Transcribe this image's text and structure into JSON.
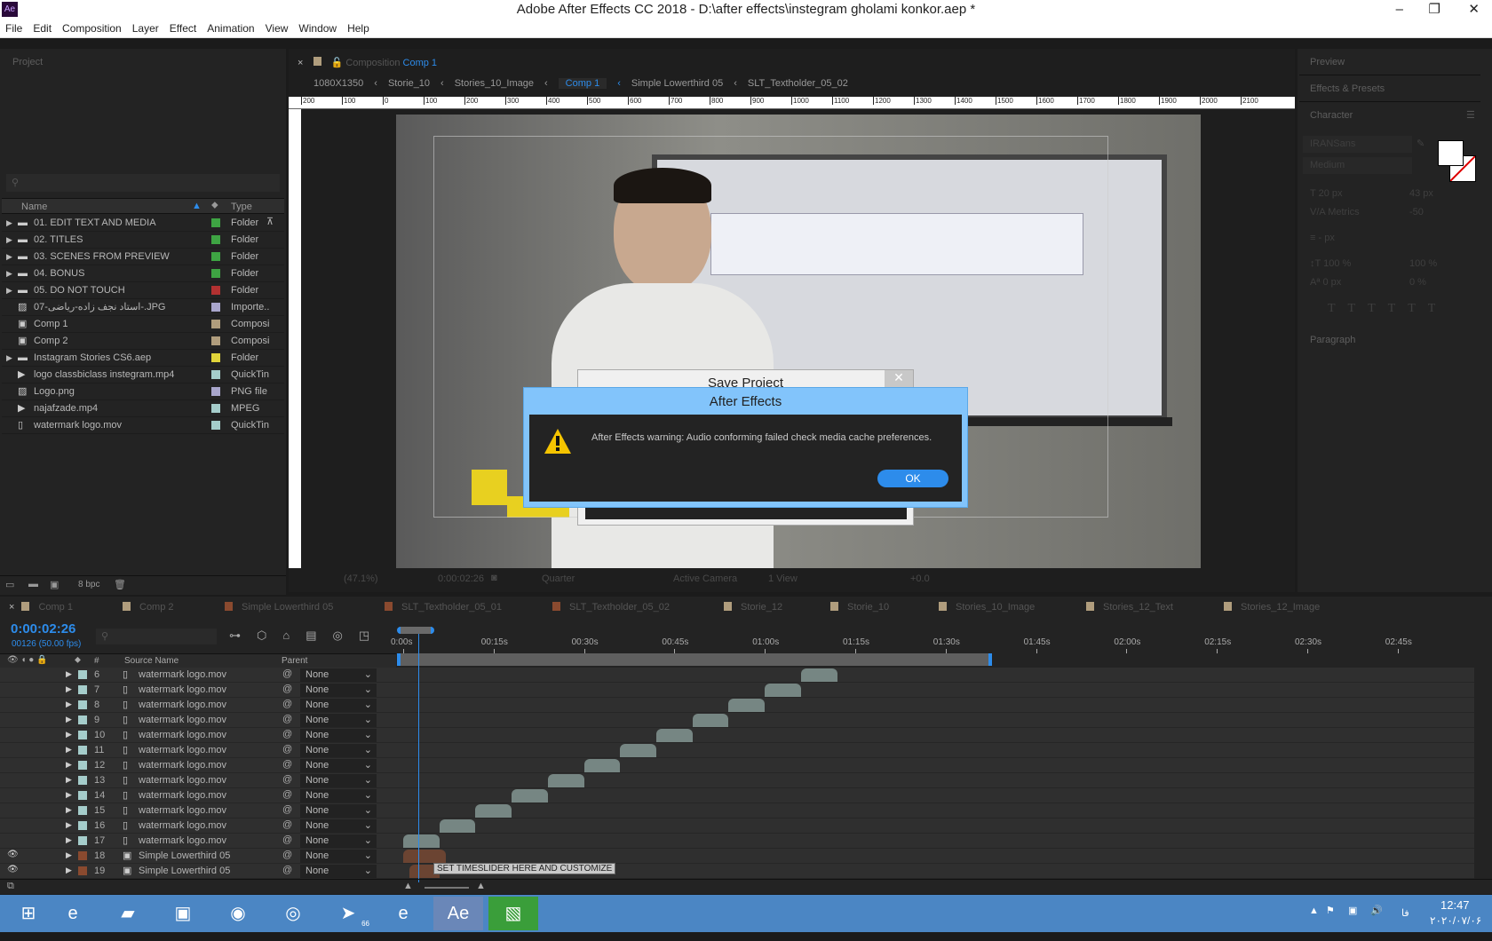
{
  "window": {
    "title": "Adobe After Effects CC 2018 - D:\\after effects\\instegram gholami konkor.aep *",
    "app_icon": "Ae"
  },
  "menu": [
    "File",
    "Edit",
    "Composition",
    "Layer",
    "Effect",
    "Animation",
    "View",
    "Window",
    "Help"
  ],
  "project": {
    "title": "Project",
    "columns": {
      "name": "Name",
      "type": "Type"
    },
    "bpc": "8 bpc",
    "items": [
      {
        "name": "01. EDIT TEXT AND MEDIA",
        "type": "Folder",
        "color": "#3ea443",
        "icon": "folder"
      },
      {
        "name": "02. TITLES",
        "type": "Folder",
        "color": "#3ea443",
        "icon": "folder"
      },
      {
        "name": "03. SCENES FROM PREVIEW",
        "type": "Folder",
        "color": "#3ea443",
        "icon": "folder"
      },
      {
        "name": "04. BONUS",
        "type": "Folder",
        "color": "#3ea443",
        "icon": "folder"
      },
      {
        "name": "05. DO NOT TOUCH",
        "type": "Folder",
        "color": "#b23131",
        "icon": "folder"
      },
      {
        "name": "07-استاد نجف زاده-ریاضی-.JPG",
        "type": "Importe..",
        "color": "#a9a6cc",
        "icon": "image"
      },
      {
        "name": "Comp 1",
        "type": "Composi",
        "color": "#b09d7d",
        "icon": "comp"
      },
      {
        "name": "Comp 2",
        "type": "Composi",
        "color": "#b09d7d",
        "icon": "comp"
      },
      {
        "name": "Instagram Stories CS6.aep",
        "type": "Folder",
        "color": "#e0d43a",
        "icon": "folder"
      },
      {
        "name": "logo classbiclass instegram.mp4",
        "type": "QuickTin",
        "color": "#a5cdcb",
        "icon": "video"
      },
      {
        "name": "Logo.png",
        "type": "PNG file",
        "color": "#a9a6cc",
        "icon": "image"
      },
      {
        "name": "najafzade.mp4",
        "type": "MPEG",
        "color": "#a5cdcb",
        "icon": "video"
      },
      {
        "name": "watermark logo.mov",
        "type": "QuickTin",
        "color": "#a5cdcb",
        "icon": "movie"
      }
    ]
  },
  "composition": {
    "panel_label": "Composition",
    "active": "Comp 1",
    "breadcrumbs": [
      "1080X1350",
      "Storie_10",
      "Stories_10_Image",
      "Comp 1",
      "Simple Lowerthird 05",
      "SLT_Textholder_05_02"
    ],
    "ruler": [
      "200",
      "100",
      "0",
      "100",
      "200",
      "300",
      "400",
      "500",
      "600",
      "700",
      "800",
      "900",
      "1000",
      "1100",
      "1200",
      "1300",
      "1400",
      "1500",
      "1600",
      "1700",
      "1800",
      "1900",
      "2000",
      "2100"
    ],
    "footer": {
      "zoom": "(47.1%)",
      "time": "0:00:02:26",
      "resolution": "Quarter",
      "camera": "Active Camera",
      "view": "1 View",
      "exposure": "+0.0"
    }
  },
  "right": {
    "preview": "Preview",
    "effects": "Effects & Presets",
    "character": "Character",
    "paragraph": "Paragraph",
    "font": "IRANSans",
    "style": "Medium",
    "size": "20 px",
    "leading": "43 px",
    "kerning": "Metrics",
    "tracking": "-50",
    "stroke": "- px",
    "vscale": "100 %",
    "hscale": "100 %",
    "baseline": "0 px",
    "tsume": "0 %"
  },
  "dialogs": {
    "save_title": "Save Project",
    "title": "After Effects",
    "message": "After Effects warning: Audio conforming failed check media cache preferences.",
    "ok": "OK",
    "accent": "#2d8ceb"
  },
  "timeline": {
    "time": "0:00:02:26",
    "frames": "00126 (50.00 fps)",
    "tabs": [
      {
        "label": "Comp 1",
        "color": "#b09d7d"
      },
      {
        "label": "Comp 2",
        "color": "#b09d7d"
      },
      {
        "label": "Simple Lowerthird 05",
        "color": "#8a4a2f"
      },
      {
        "label": "SLT_Textholder_05_01",
        "color": "#8a4a2f"
      },
      {
        "label": "SLT_Textholder_05_02",
        "color": "#8a4a2f"
      },
      {
        "label": "Storie_12",
        "color": "#b09d7d"
      },
      {
        "label": "Storie_10",
        "color": "#b09d7d"
      },
      {
        "label": "Stories_10_Image",
        "color": "#b09d7d"
      },
      {
        "label": "Stories_12_Text",
        "color": "#b09d7d"
      },
      {
        "label": "Stories_12_Image",
        "color": "#b09d7d"
      }
    ],
    "columns": {
      "num": "#",
      "source": "Source Name",
      "parent": "Parent"
    },
    "ticks": [
      "0:00s",
      "00:15s",
      "00:30s",
      "00:45s",
      "01:00s",
      "01:15s",
      "01:30s",
      "01:45s",
      "02:00s",
      "02:15s",
      "02:30s",
      "02:45s"
    ],
    "playhead_seconds": 2.52,
    "layers": [
      {
        "n": "6",
        "name": "watermark logo.mov",
        "parent": "None",
        "start": 66,
        "dur": 6,
        "color": "#a5cdcb"
      },
      {
        "n": "7",
        "name": "watermark logo.mov",
        "parent": "None",
        "start": 60,
        "dur": 6,
        "color": "#a5cdcb"
      },
      {
        "n": "8",
        "name": "watermark logo.mov",
        "parent": "None",
        "start": 54,
        "dur": 6,
        "color": "#a5cdcb"
      },
      {
        "n": "9",
        "name": "watermark logo.mov",
        "parent": "None",
        "start": 48,
        "dur": 6,
        "color": "#a5cdcb"
      },
      {
        "n": "10",
        "name": "watermark logo.mov",
        "parent": "None",
        "start": 42,
        "dur": 6,
        "color": "#a5cdcb"
      },
      {
        "n": "11",
        "name": "watermark logo.mov",
        "parent": "None",
        "start": 36,
        "dur": 6,
        "color": "#a5cdcb"
      },
      {
        "n": "12",
        "name": "watermark logo.mov",
        "parent": "None",
        "start": 30,
        "dur": 6,
        "color": "#a5cdcb"
      },
      {
        "n": "13",
        "name": "watermark logo.mov",
        "parent": "None",
        "start": 24,
        "dur": 6,
        "color": "#a5cdcb"
      },
      {
        "n": "14",
        "name": "watermark logo.mov",
        "parent": "None",
        "start": 18,
        "dur": 6,
        "color": "#a5cdcb"
      },
      {
        "n": "15",
        "name": "watermark logo.mov",
        "parent": "None",
        "start": 12,
        "dur": 6,
        "color": "#a5cdcb"
      },
      {
        "n": "16",
        "name": "watermark logo.mov",
        "parent": "None",
        "start": 6,
        "dur": 6,
        "color": "#a5cdcb"
      },
      {
        "n": "17",
        "name": "watermark logo.mov",
        "parent": "None",
        "start": 0,
        "dur": 6,
        "color": "#a5cdcb"
      },
      {
        "n": "18",
        "name": "Simple Lowerthird 05",
        "parent": "None",
        "start": 0,
        "dur": 7,
        "color": "#8a4a2f",
        "visible": true
      },
      {
        "n": "19",
        "name": "Simple Lowerthird 05",
        "parent": "None",
        "start": 1,
        "dur": 5,
        "color": "#8a4a2f",
        "visible": true
      }
    ],
    "marker_comment": "SET TIMESLIDER HERE AND CUSTOMIZE"
  },
  "taskbar": {
    "time": "12:47",
    "date": "۲۰۲۰/۰۷/۰۶",
    "lang": "فا",
    "apps": [
      "start",
      "internet-explorer",
      "file-explorer",
      "store",
      "firefox",
      "chrome",
      "telegram",
      "e-app",
      "after-effects",
      "media-encoder"
    ],
    "telegram_badge": "66"
  }
}
